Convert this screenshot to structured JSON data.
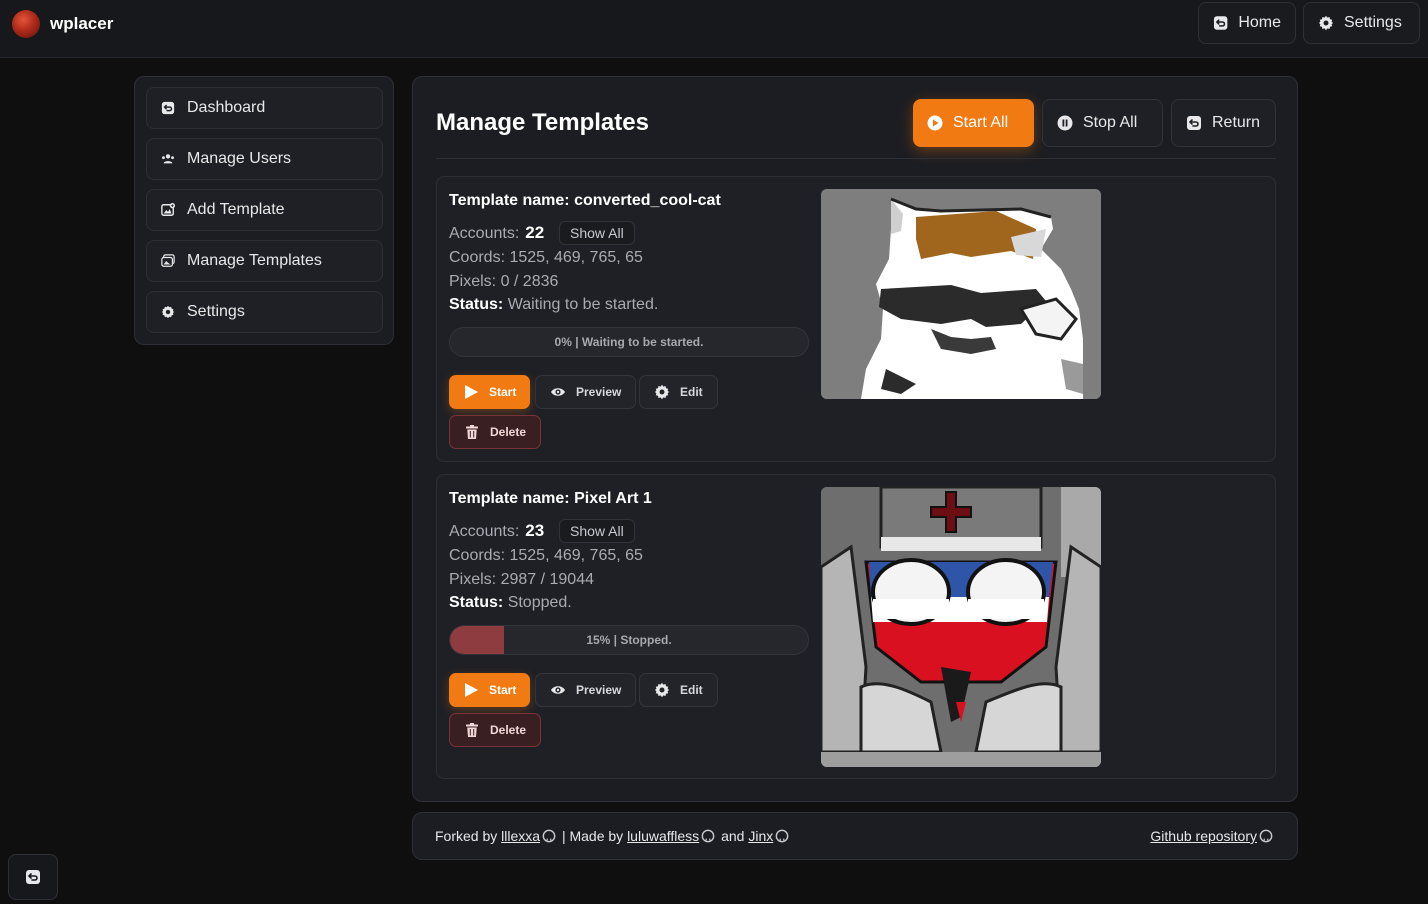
{
  "app": {
    "brand": "wplacer"
  },
  "topnav": {
    "home": "Home",
    "settings": "Settings"
  },
  "sidebar": {
    "items": [
      {
        "label": "Dashboard",
        "icon": "dashboard-icon"
      },
      {
        "label": "Manage Users",
        "icon": "users-icon"
      },
      {
        "label": "Add Template",
        "icon": "add-image-icon"
      },
      {
        "label": "Manage Templates",
        "icon": "images-icon"
      },
      {
        "label": "Settings",
        "icon": "gear-icon"
      }
    ]
  },
  "main": {
    "title": "Manage Templates",
    "start_all": "Start All",
    "stop_all": "Stop All",
    "return": "Return"
  },
  "templates": [
    {
      "name_label": "Template name: converted_cool-cat",
      "accounts_label": "Accounts:",
      "accounts": "22",
      "show_all": "Show All",
      "coords": "Coords: 1525, 469, 765, 65",
      "pixels": "Pixels: 0 / 2836",
      "status_label": "Status:",
      "status": "Waiting to be started.",
      "progress_percent": 0,
      "progress_text": "0% | Waiting to be started.",
      "start": "Start",
      "preview": "Preview",
      "edit": "Edit",
      "delete": "Delete"
    },
    {
      "name_label": "Template name: Pixel Art 1",
      "accounts_label": "Accounts:",
      "accounts": "23",
      "show_all": "Show All",
      "coords": "Coords: 1525, 469, 765, 65",
      "pixels": "Pixels: 2987 / 19044",
      "status_label": "Status:",
      "status": "Stopped.",
      "progress_percent": 15,
      "progress_text": "15% | Stopped.",
      "start": "Start",
      "preview": "Preview",
      "edit": "Edit",
      "delete": "Delete"
    }
  ],
  "footer": {
    "forked_by": "Forked by",
    "forker": "lllexxa",
    "made_by": "| Made by",
    "author1": "luluwaffless",
    "and": "and",
    "author2": "Jinx",
    "repo": "Github repository"
  },
  "colors": {
    "accent": "#f27a12",
    "danger": "#8e3c3f",
    "background": "#0f0f10",
    "panel": "#1c1d22"
  }
}
